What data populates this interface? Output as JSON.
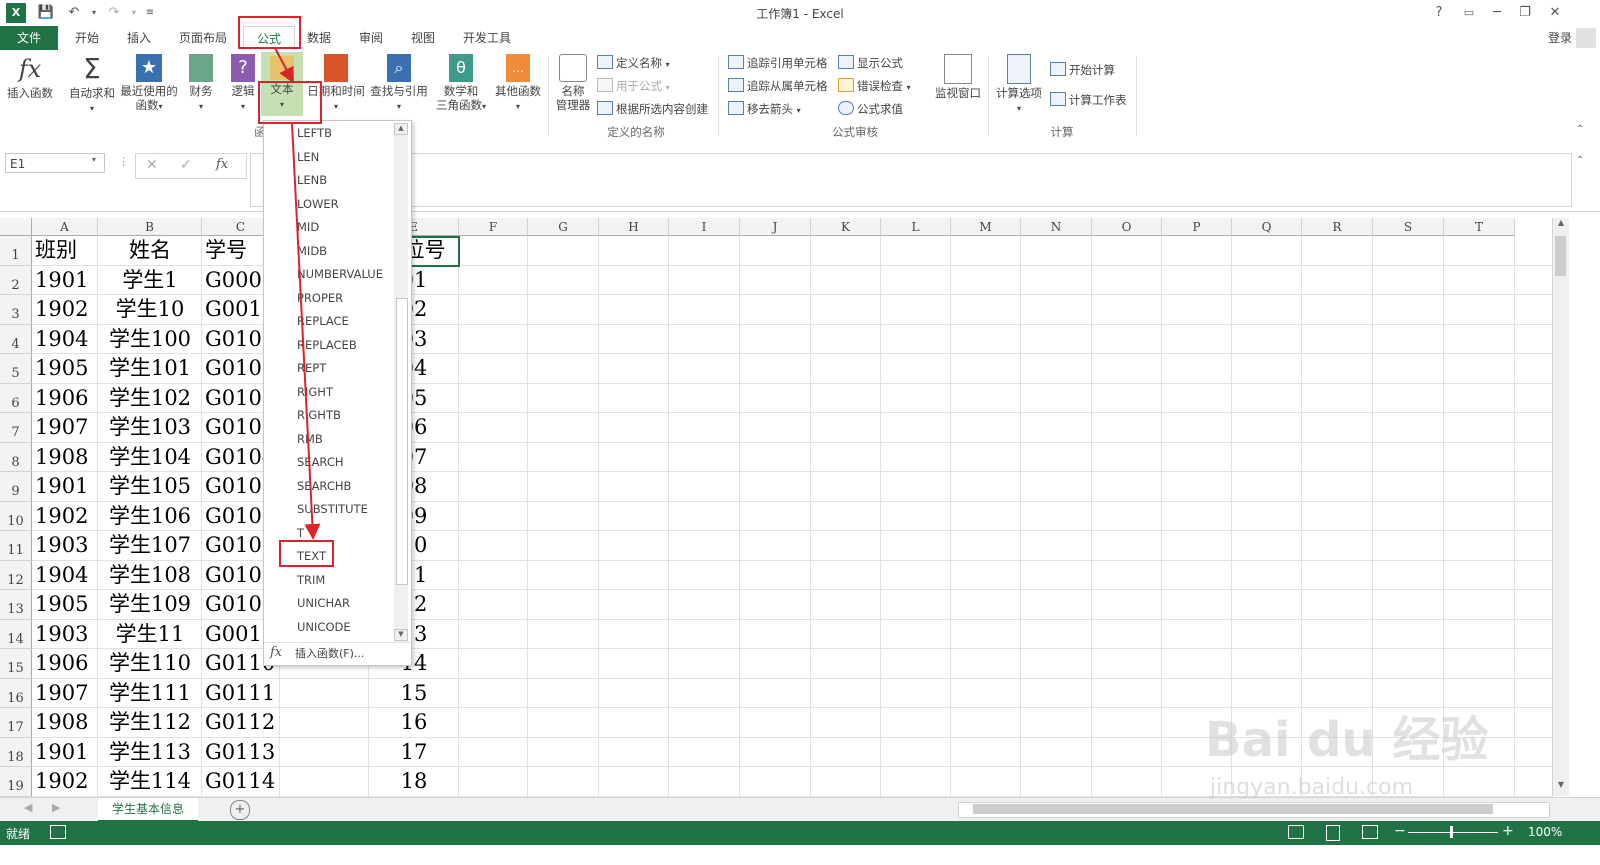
{
  "window": {
    "title": "工作簿1 - Excel",
    "login": "登录",
    "help": "?",
    "minimize": "─",
    "restore": "❐",
    "close": "✕"
  },
  "tabs": [
    {
      "label": "文件"
    },
    {
      "label": "开始"
    },
    {
      "label": "插入"
    },
    {
      "label": "页面布局"
    },
    {
      "label": "公式"
    },
    {
      "label": "数据"
    },
    {
      "label": "审阅"
    },
    {
      "label": "视图"
    },
    {
      "label": "开发工具"
    }
  ],
  "ribbon": {
    "insert_function": "插入函数",
    "autosum": "自动求和",
    "recent_1": "最近使用的",
    "recent_2": "函数",
    "finance": "财务",
    "logic": "逻辑",
    "text": "文本",
    "datetime": "日期和时间",
    "lookup": "查找与引用",
    "math_1": "数学和",
    "math_2": "三角函数",
    "other": "其他函数",
    "name_mgr_1": "名称",
    "name_mgr_2": "管理器",
    "define_name": "定义名称",
    "use_in_formula": "用于公式",
    "create_from_sel": "根据所选内容创建",
    "group_defined_names": "定义的名称",
    "trace_precedents": "追踪引用单元格",
    "trace_dependents": "追踪从属单元格",
    "remove_arrows": "移去箭头",
    "show_formulas": "显示公式",
    "error_check": "错误检查",
    "evaluate": "公式求值",
    "group_audit": "公式审核",
    "watch_window": "监视窗口",
    "calc_options": "计算选项",
    "calc_now": "开始计算",
    "calc_sheet": "计算工作表",
    "group_calc": "计算",
    "group_lib_partial": "函"
  },
  "formula_bar": {
    "name_box": "E1",
    "fx": "fx"
  },
  "columns": [
    "A",
    "B",
    "C",
    "D",
    "E",
    "F",
    "G",
    "H",
    "I",
    "J",
    "K",
    "L",
    "M",
    "N",
    "O",
    "P",
    "Q",
    "R",
    "S",
    "T"
  ],
  "rows": [
    "1",
    "2",
    "3",
    "4",
    "5",
    "6",
    "7",
    "8",
    "9",
    "10",
    "11",
    "12",
    "13",
    "14",
    "15",
    "16",
    "17",
    "18",
    "19"
  ],
  "cells": {
    "A": [
      "班别",
      "1901",
      "1902",
      "1904",
      "1905",
      "1906",
      "1907",
      "1908",
      "1901",
      "1902",
      "1903",
      "1904",
      "1905",
      "1903",
      "1906",
      "1907",
      "1908",
      "1901",
      "1902"
    ],
    "B": [
      "姓名",
      "学生1",
      "学生10",
      "学生100",
      "学生101",
      "学生102",
      "学生103",
      "学生104",
      "学生105",
      "学生106",
      "学生107",
      "学生108",
      "学生109",
      "学生11",
      "学生110",
      "学生111",
      "学生112",
      "学生113",
      "学生114"
    ],
    "C": [
      "学号",
      "G0001",
      "G0010",
      "G0100",
      "G0101",
      "G0102",
      "G0103",
      "G0104",
      "G0105",
      "G0106",
      "G0107",
      "G0108",
      "G0109",
      "G0011",
      "G0110",
      "G0111",
      "G0112",
      "G0113",
      "G0114"
    ],
    "E": [
      "座位号",
      "01",
      "02",
      "03",
      "04",
      "05",
      "06",
      "07",
      "08",
      "09",
      "10",
      "11",
      "12",
      "13",
      "14",
      "15",
      "16",
      "17",
      "18"
    ]
  },
  "dropdown": {
    "items": [
      "LEFTB",
      "LEN",
      "LENB",
      "LOWER",
      "MID",
      "MIDB",
      "NUMBERVALUE",
      "PROPER",
      "REPLACE",
      "REPLACEB",
      "REPT",
      "RIGHT",
      "RIGHTB",
      "RMB",
      "SEARCH",
      "SEARCHB",
      "SUBSTITUTE",
      "T",
      "TEXT",
      "TRIM",
      "UNICHAR",
      "UNICODE"
    ],
    "insert_function": "插入函数(F)..."
  },
  "sheet_tabs": {
    "sheet1": "学生基本信息",
    "add": "+"
  },
  "status": {
    "ready": "就绪",
    "zoom": "100%"
  },
  "watermark": {
    "line1": "Bai du 经验",
    "line2": "jingyan.baidu.com"
  },
  "colors": {
    "accent": "#217346",
    "highlight": "#d9242b"
  }
}
